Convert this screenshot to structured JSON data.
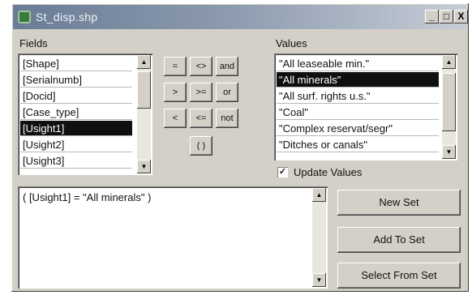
{
  "window": {
    "title": "St_disp.shp"
  },
  "fields": {
    "label": "Fields",
    "items": [
      "[Shape]",
      "[Serialnumb]",
      "[Docid]",
      "[Case_type]",
      "[Usight1]",
      "[Usight2]",
      "[Usight3]"
    ],
    "selected_index": 4
  },
  "operators": [
    "=",
    "<>",
    "and",
    ">",
    ">=",
    "or",
    "<",
    "<=",
    "not",
    "( )"
  ],
  "values": {
    "label": "Values",
    "items": [
      "\"All leaseable min.\"",
      "\"All minerals\"",
      "\"All surf. rights u.s.\"",
      "\"Coal\"",
      "\"Complex reservat/segr\"",
      "\"Ditches or canals\""
    ],
    "selected_index": 1
  },
  "update_values": {
    "label": "Update Values",
    "checked": true,
    "check_mark": "✓"
  },
  "expression": "( [Usight1] = \"All minerals\" )",
  "buttons": {
    "new_set": "New Set",
    "add_to_set": "Add To Set",
    "select_from_set": "Select From Set"
  },
  "title_buttons": {
    "minimize": "_",
    "maximize": "□",
    "close": "X"
  },
  "scroll_arrows": {
    "up": "▲",
    "down": "▼"
  }
}
